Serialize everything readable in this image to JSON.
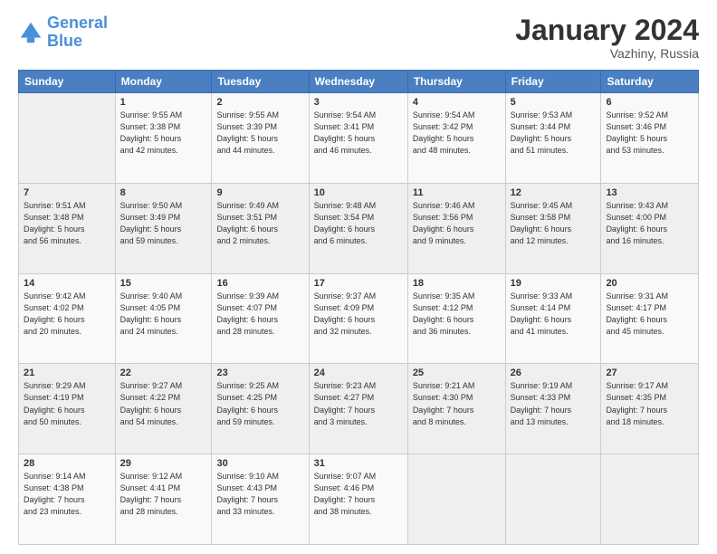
{
  "header": {
    "logo_line1": "General",
    "logo_line2": "Blue",
    "month": "January 2024",
    "location": "Vazhiny, Russia"
  },
  "weekdays": [
    "Sunday",
    "Monday",
    "Tuesday",
    "Wednesday",
    "Thursday",
    "Friday",
    "Saturday"
  ],
  "weeks": [
    [
      {
        "day": "",
        "info": ""
      },
      {
        "day": "1",
        "info": "Sunrise: 9:55 AM\nSunset: 3:38 PM\nDaylight: 5 hours\nand 42 minutes."
      },
      {
        "day": "2",
        "info": "Sunrise: 9:55 AM\nSunset: 3:39 PM\nDaylight: 5 hours\nand 44 minutes."
      },
      {
        "day": "3",
        "info": "Sunrise: 9:54 AM\nSunset: 3:41 PM\nDaylight: 5 hours\nand 46 minutes."
      },
      {
        "day": "4",
        "info": "Sunrise: 9:54 AM\nSunset: 3:42 PM\nDaylight: 5 hours\nand 48 minutes."
      },
      {
        "day": "5",
        "info": "Sunrise: 9:53 AM\nSunset: 3:44 PM\nDaylight: 5 hours\nand 51 minutes."
      },
      {
        "day": "6",
        "info": "Sunrise: 9:52 AM\nSunset: 3:46 PM\nDaylight: 5 hours\nand 53 minutes."
      }
    ],
    [
      {
        "day": "7",
        "info": "Sunrise: 9:51 AM\nSunset: 3:48 PM\nDaylight: 5 hours\nand 56 minutes."
      },
      {
        "day": "8",
        "info": "Sunrise: 9:50 AM\nSunset: 3:49 PM\nDaylight: 5 hours\nand 59 minutes."
      },
      {
        "day": "9",
        "info": "Sunrise: 9:49 AM\nSunset: 3:51 PM\nDaylight: 6 hours\nand 2 minutes."
      },
      {
        "day": "10",
        "info": "Sunrise: 9:48 AM\nSunset: 3:54 PM\nDaylight: 6 hours\nand 6 minutes."
      },
      {
        "day": "11",
        "info": "Sunrise: 9:46 AM\nSunset: 3:56 PM\nDaylight: 6 hours\nand 9 minutes."
      },
      {
        "day": "12",
        "info": "Sunrise: 9:45 AM\nSunset: 3:58 PM\nDaylight: 6 hours\nand 12 minutes."
      },
      {
        "day": "13",
        "info": "Sunrise: 9:43 AM\nSunset: 4:00 PM\nDaylight: 6 hours\nand 16 minutes."
      }
    ],
    [
      {
        "day": "14",
        "info": "Sunrise: 9:42 AM\nSunset: 4:02 PM\nDaylight: 6 hours\nand 20 minutes."
      },
      {
        "day": "15",
        "info": "Sunrise: 9:40 AM\nSunset: 4:05 PM\nDaylight: 6 hours\nand 24 minutes."
      },
      {
        "day": "16",
        "info": "Sunrise: 9:39 AM\nSunset: 4:07 PM\nDaylight: 6 hours\nand 28 minutes."
      },
      {
        "day": "17",
        "info": "Sunrise: 9:37 AM\nSunset: 4:09 PM\nDaylight: 6 hours\nand 32 minutes."
      },
      {
        "day": "18",
        "info": "Sunrise: 9:35 AM\nSunset: 4:12 PM\nDaylight: 6 hours\nand 36 minutes."
      },
      {
        "day": "19",
        "info": "Sunrise: 9:33 AM\nSunset: 4:14 PM\nDaylight: 6 hours\nand 41 minutes."
      },
      {
        "day": "20",
        "info": "Sunrise: 9:31 AM\nSunset: 4:17 PM\nDaylight: 6 hours\nand 45 minutes."
      }
    ],
    [
      {
        "day": "21",
        "info": "Sunrise: 9:29 AM\nSunset: 4:19 PM\nDaylight: 6 hours\nand 50 minutes."
      },
      {
        "day": "22",
        "info": "Sunrise: 9:27 AM\nSunset: 4:22 PM\nDaylight: 6 hours\nand 54 minutes."
      },
      {
        "day": "23",
        "info": "Sunrise: 9:25 AM\nSunset: 4:25 PM\nDaylight: 6 hours\nand 59 minutes."
      },
      {
        "day": "24",
        "info": "Sunrise: 9:23 AM\nSunset: 4:27 PM\nDaylight: 7 hours\nand 3 minutes."
      },
      {
        "day": "25",
        "info": "Sunrise: 9:21 AM\nSunset: 4:30 PM\nDaylight: 7 hours\nand 8 minutes."
      },
      {
        "day": "26",
        "info": "Sunrise: 9:19 AM\nSunset: 4:33 PM\nDaylight: 7 hours\nand 13 minutes."
      },
      {
        "day": "27",
        "info": "Sunrise: 9:17 AM\nSunset: 4:35 PM\nDaylight: 7 hours\nand 18 minutes."
      }
    ],
    [
      {
        "day": "28",
        "info": "Sunrise: 9:14 AM\nSunset: 4:38 PM\nDaylight: 7 hours\nand 23 minutes."
      },
      {
        "day": "29",
        "info": "Sunrise: 9:12 AM\nSunset: 4:41 PM\nDaylight: 7 hours\nand 28 minutes."
      },
      {
        "day": "30",
        "info": "Sunrise: 9:10 AM\nSunset: 4:43 PM\nDaylight: 7 hours\nand 33 minutes."
      },
      {
        "day": "31",
        "info": "Sunrise: 9:07 AM\nSunset: 4:46 PM\nDaylight: 7 hours\nand 38 minutes."
      },
      {
        "day": "",
        "info": ""
      },
      {
        "day": "",
        "info": ""
      },
      {
        "day": "",
        "info": ""
      }
    ]
  ]
}
